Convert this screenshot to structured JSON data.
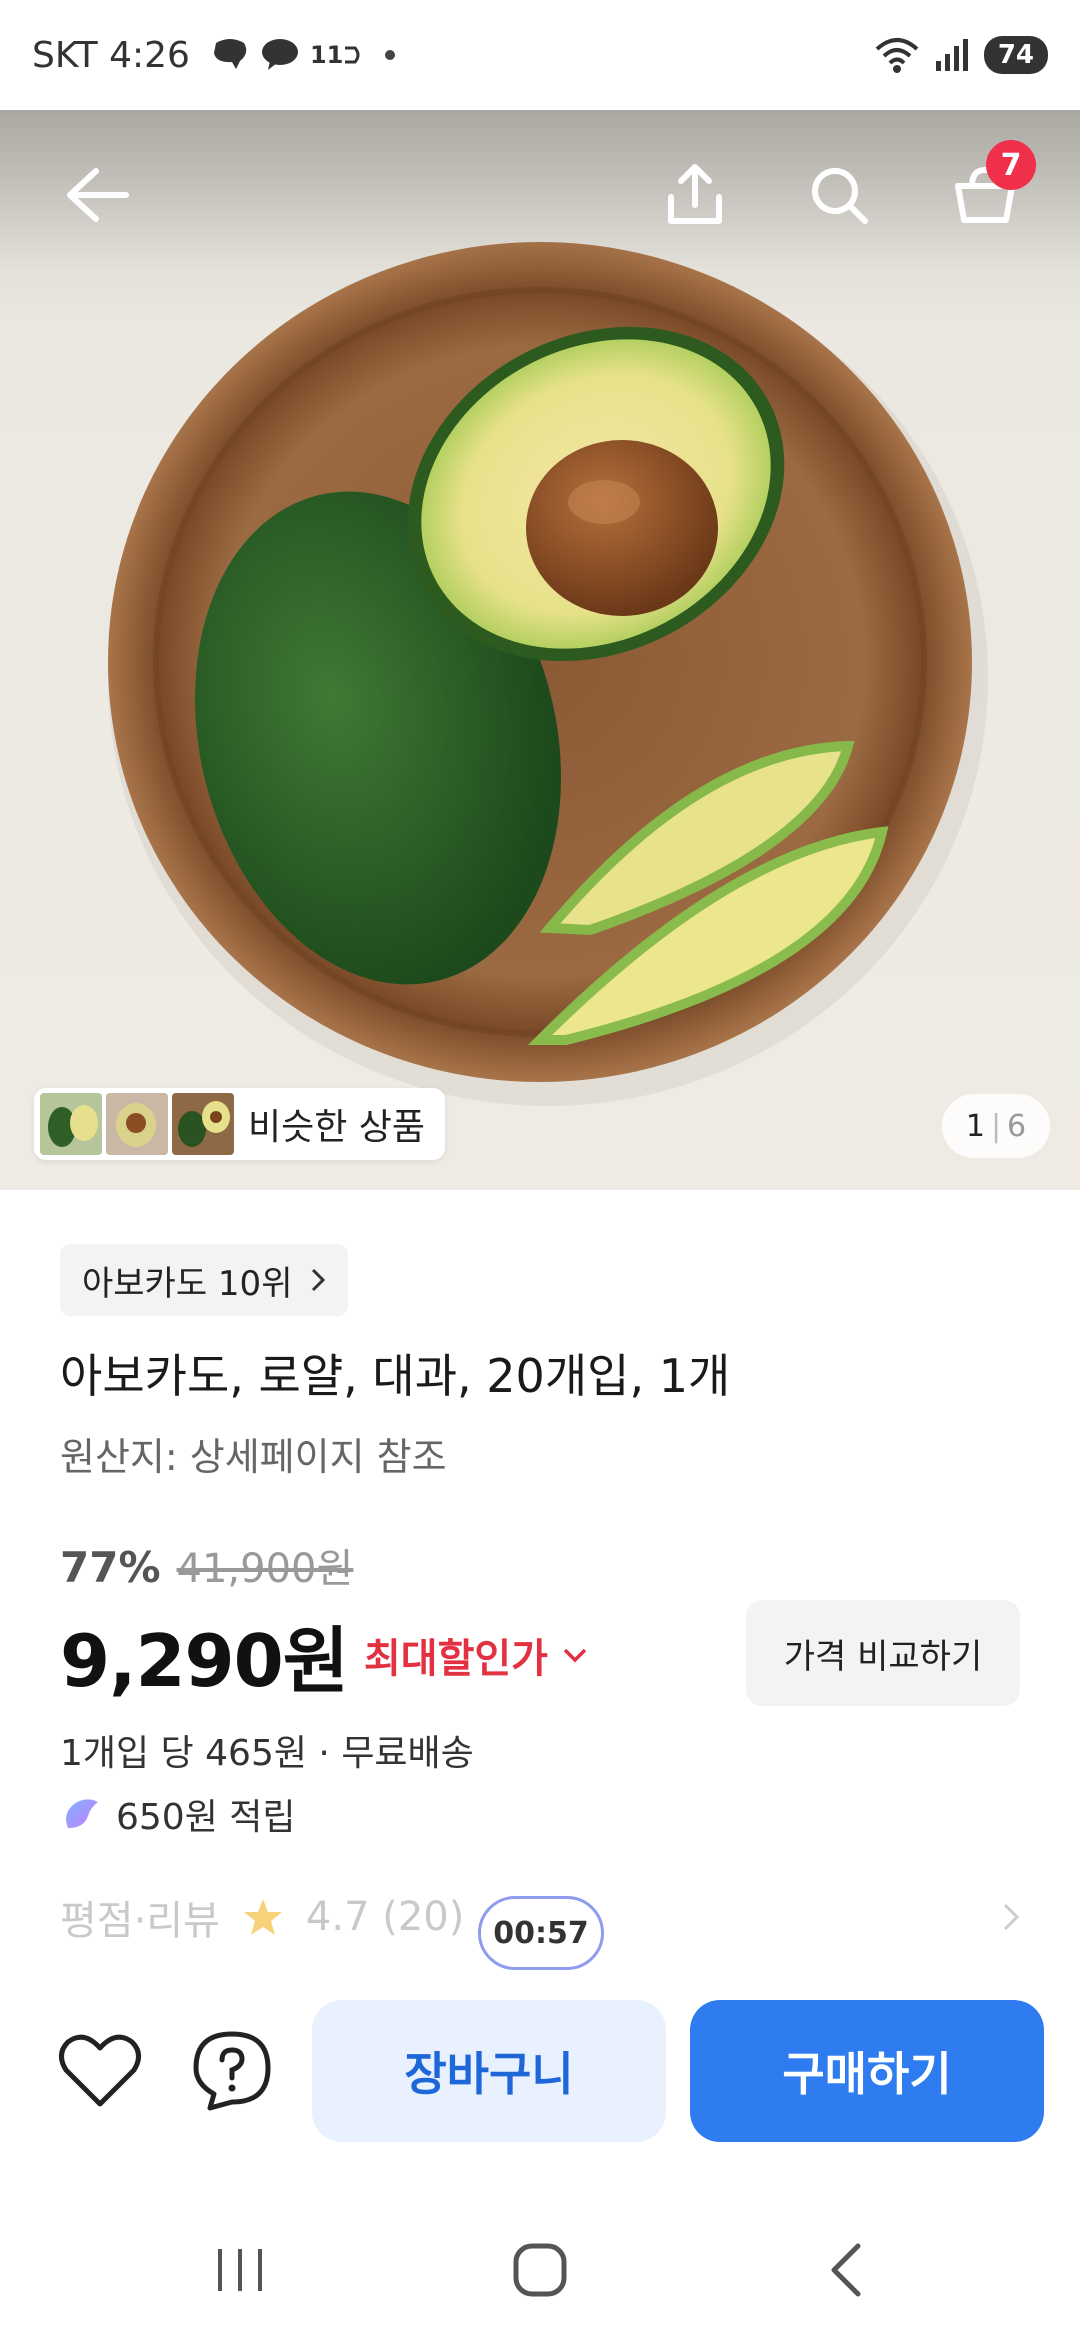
{
  "status_bar": {
    "carrier_time": "SKT 4:26",
    "network_label": "11",
    "battery": "74",
    "icons": [
      "chat-bubble-icon",
      "kakaotalk-icon",
      "11st-icon",
      "wifi-icon",
      "signal-icon",
      "battery-icon"
    ]
  },
  "header": {
    "cart_count": "7",
    "icons": [
      "back-arrow-icon",
      "share-icon",
      "search-icon",
      "cart-icon"
    ]
  },
  "gallery": {
    "similar_label": "비슷한 상품",
    "current_page": "1",
    "separator": "|",
    "total_pages": "6"
  },
  "product": {
    "rank_chip": "아보카도 10위",
    "title": "아보카도, 로얄, 대과, 20개입, 1개",
    "origin": "원산지: 상세페이지 참조",
    "discount_rate": "77%",
    "original_price": "41,900원",
    "price": "9,290원",
    "max_discount_label": "최대할인가",
    "compare_label": "가격 비교하기",
    "per_unit": "1개입 당 465원 · 무료배송",
    "points": "650원 적립",
    "rating_label": "평점·리뷰",
    "rating_value": "4.7 (20)",
    "timer": "00:57"
  },
  "actions": {
    "cart_label": "장바구니",
    "buy_label": "구매하기"
  },
  "colors": {
    "accent_blue": "#2f7cf0",
    "discount_red": "#e23241",
    "badge_red": "#f0304a"
  }
}
